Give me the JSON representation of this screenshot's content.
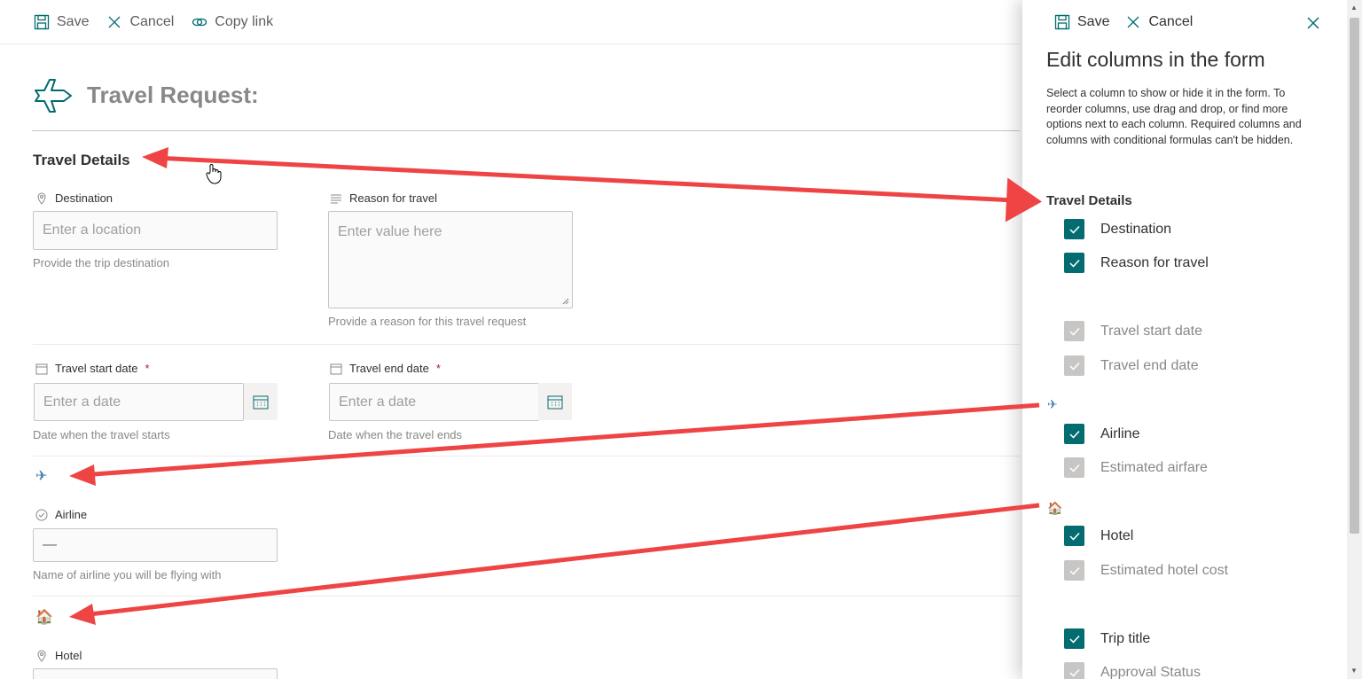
{
  "toolbar": {
    "save": "Save",
    "cancel": "Cancel",
    "copy_link": "Copy link"
  },
  "form": {
    "title": "Travel Request:",
    "section": "Travel Details",
    "destination": {
      "label": "Destination",
      "placeholder": "Enter a location",
      "help": "Provide the trip destination"
    },
    "reason": {
      "label": "Reason for travel",
      "placeholder": "Enter value here",
      "help": "Provide a reason for this travel request"
    },
    "start_date": {
      "label": "Travel start date",
      "required": "*",
      "placeholder": "Enter a date",
      "help": "Date when the travel starts"
    },
    "end_date": {
      "label": "Travel end date",
      "required": "*",
      "placeholder": "Enter a date",
      "help": "Date when the travel ends"
    },
    "airline_section_icon": "✈",
    "airline": {
      "label": "Airline",
      "value": "—",
      "help": "Name of airline you will be flying with"
    },
    "hotel_section_icon": "🏠",
    "hotel": {
      "label": "Hotel"
    }
  },
  "panel": {
    "save": "Save",
    "cancel": "Cancel",
    "title": "Edit columns in the form",
    "description": "Select a column to show or hide it in the form. To reorder columns, use drag and drop, or find more options next to each column. Required columns and columns with conditional formulas can't be hidden.",
    "section": "Travel Details",
    "airline_icon": "✈",
    "hotel_icon": "🏠",
    "columns": [
      {
        "label": "Destination",
        "checked": true,
        "enabled": true
      },
      {
        "label": "Reason for travel",
        "checked": true,
        "enabled": true
      },
      {
        "label": "Travel start date",
        "checked": true,
        "enabled": false
      },
      {
        "label": "Travel end date",
        "checked": true,
        "enabled": false
      },
      {
        "label": "Airline",
        "checked": true,
        "enabled": true
      },
      {
        "label": "Estimated airfare",
        "checked": true,
        "enabled": false
      },
      {
        "label": "Hotel",
        "checked": true,
        "enabled": true
      },
      {
        "label": "Estimated hotel cost",
        "checked": true,
        "enabled": false
      },
      {
        "label": "Trip title",
        "checked": true,
        "enabled": true
      },
      {
        "label": "Approval Status",
        "checked": true,
        "enabled": false
      }
    ]
  },
  "colors": {
    "accent": "#036c70",
    "disabled": "#c8c6c4",
    "annotation": "#ef4444"
  }
}
